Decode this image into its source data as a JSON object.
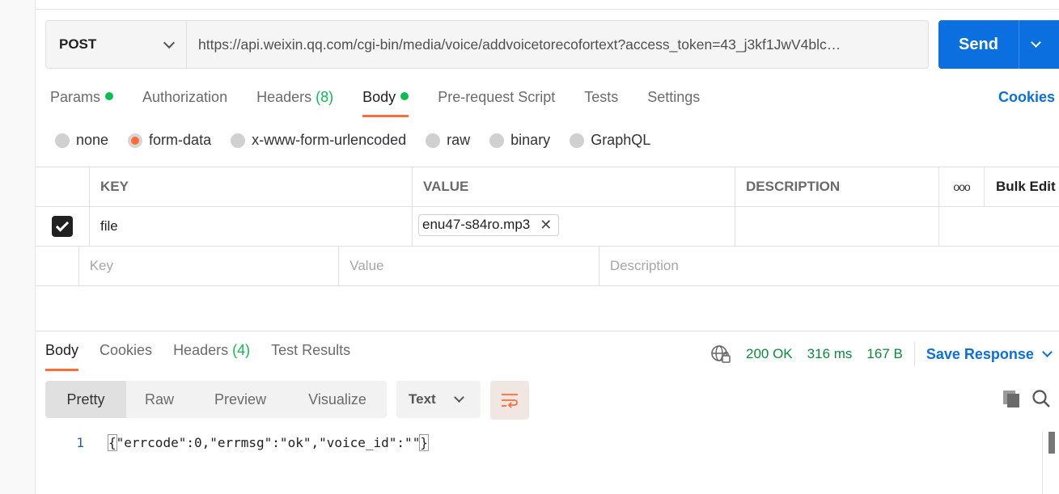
{
  "request": {
    "method": "POST",
    "url": "https://api.weixin.qq.com/cgi-bin/media/voice/addvoicetorecofortext?access_token=43_j3kf1JwV4blc…",
    "send_label": "Send"
  },
  "request_tabs": {
    "params": "Params",
    "authorization": "Authorization",
    "headers": "Headers",
    "headers_count": "(8)",
    "body": "Body",
    "prerequest": "Pre-request Script",
    "tests": "Tests",
    "settings": "Settings",
    "cookies": "Cookies"
  },
  "body_types": {
    "none": "none",
    "form_data": "form-data",
    "urlencoded": "x-www-form-urlencoded",
    "raw": "raw",
    "binary": "binary",
    "graphql": "GraphQL",
    "selected": "form-data"
  },
  "table": {
    "headers": {
      "key": "KEY",
      "value": "VALUE",
      "description": "DESCRIPTION",
      "bulk_edit": "Bulk Edit",
      "more": "ooo"
    },
    "rows": [
      {
        "checked": true,
        "key": "file",
        "value": "enu47-s84ro.mp3",
        "description": ""
      }
    ],
    "placeholders": {
      "key": "Key",
      "value": "Value",
      "description": "Description"
    }
  },
  "response_tabs": {
    "body": "Body",
    "cookies": "Cookies",
    "headers": "Headers",
    "headers_count": "(4)",
    "test_results": "Test Results"
  },
  "response_meta": {
    "status": "200 OK",
    "time": "316 ms",
    "size": "167 B",
    "save_response": "Save Response"
  },
  "view_modes": {
    "pretty": "Pretty",
    "raw": "Raw",
    "preview": "Preview",
    "visualize": "Visualize",
    "format": "Text"
  },
  "code": {
    "line_number": "1",
    "open": "{",
    "content": "\"errcode\":0,\"errmsg\":\"ok\",\"voice_id\":\"\"",
    "close": "}"
  },
  "colors": {
    "accent": "#ff6c37",
    "primary": "#0b6fe0",
    "success": "#0cbb52"
  }
}
